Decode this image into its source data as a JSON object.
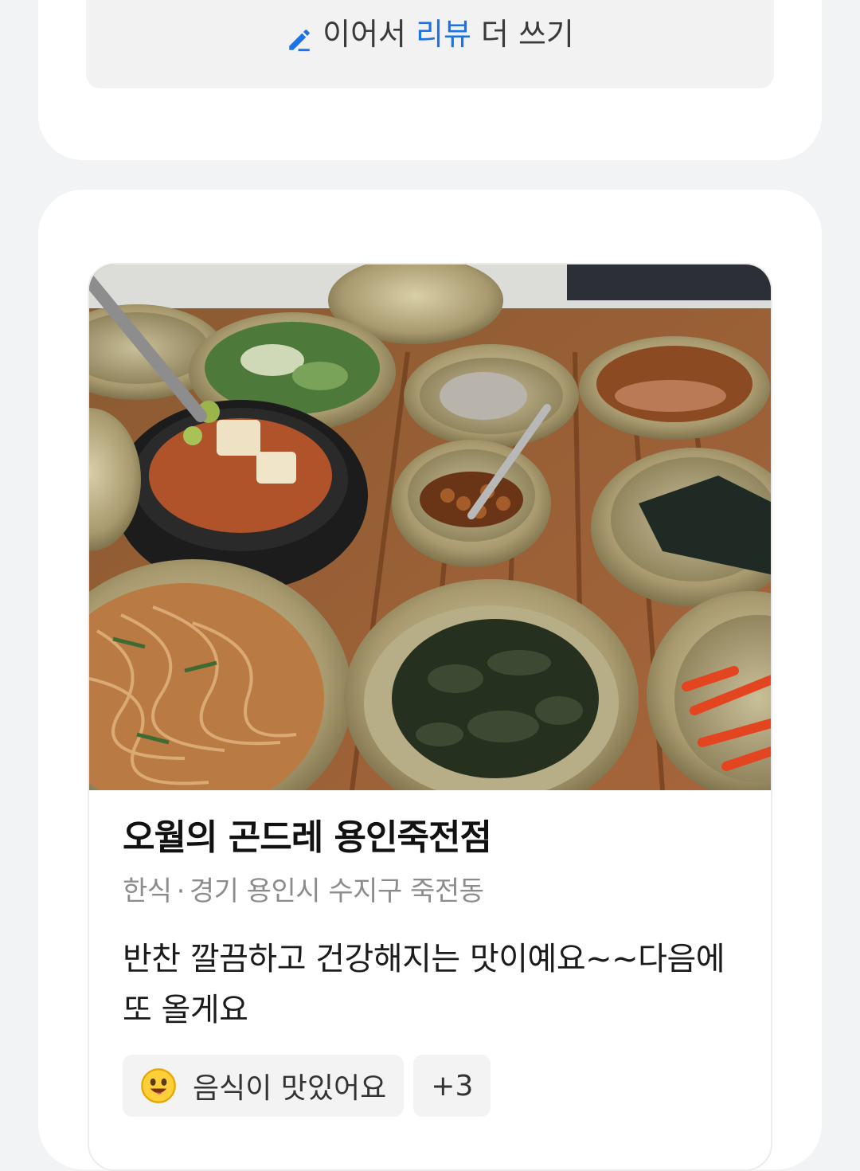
{
  "continue_review": {
    "icon": "pencil-icon",
    "prefix": "이어서",
    "highlight": "리뷰",
    "suffix": "더 쓰기",
    "accent_color": "#1a73e8"
  },
  "review": {
    "place_name": "오월의 곤드레 용인죽전점",
    "category": "한식",
    "separator": "·",
    "location": "경기 용인시 수지구 죽전동",
    "text": "반찬 깔끔하고 건강해지는 맛이예요~~다음에 또 올게요",
    "tags": [
      {
        "icon": "smiley-icon",
        "label": "음식이 맛있어요"
      }
    ],
    "more_tags_label": "+3"
  }
}
